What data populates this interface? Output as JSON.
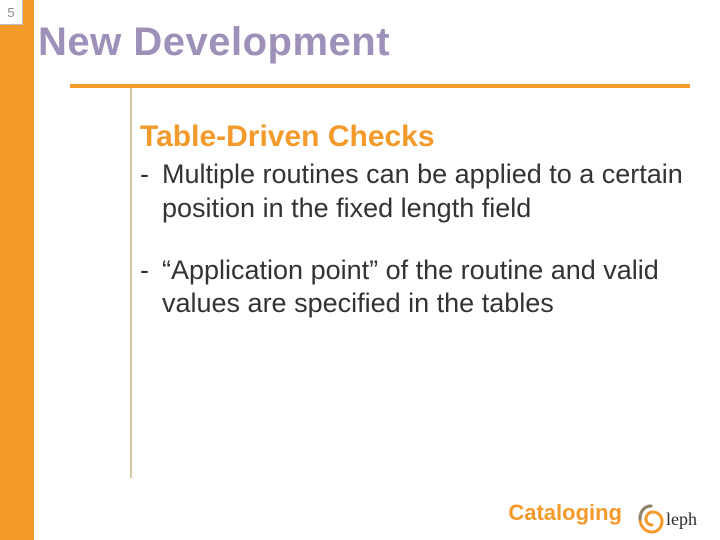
{
  "slide_number": "5",
  "heading": "New Development",
  "subheading": "Table-Driven Checks",
  "bullets": [
    {
      "dash": "-",
      "text": "Multiple routines can be applied to a certain position in the fixed length field"
    },
    {
      "dash": "-",
      "text": "“Application point” of the routine and valid values are specified in the tables"
    }
  ],
  "footer_label": "Cataloging",
  "logo_text": "leph",
  "colors": {
    "accent_orange": "#f39a2a",
    "heading_purple": "#9e91b9",
    "rule_tan": "#d6c6a0"
  }
}
